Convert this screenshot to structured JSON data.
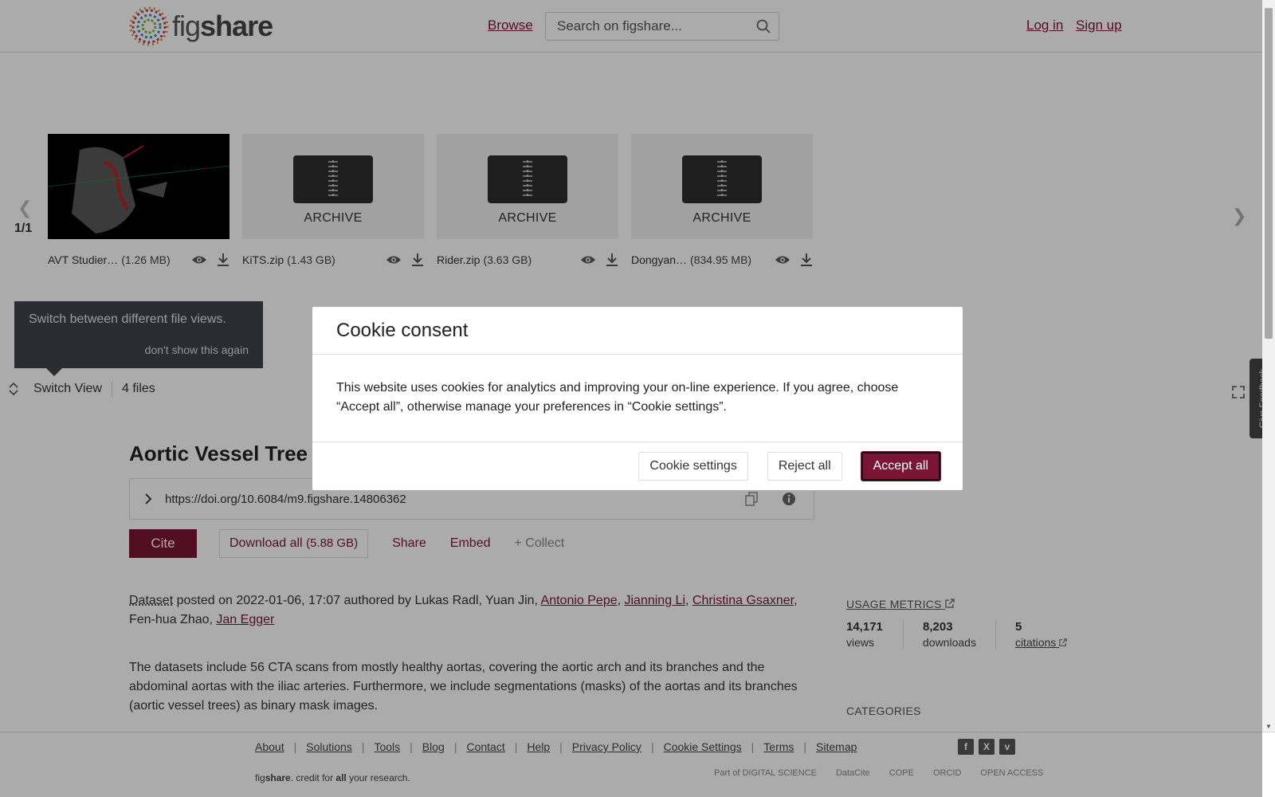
{
  "header": {
    "logo_text_a": "fig",
    "logo_text_b": "share",
    "browse": "Browse",
    "search_placeholder": "Search on figshare...",
    "login": "Log in",
    "signup": "Sign up"
  },
  "carousel": {
    "pager": "1/1",
    "files": [
      {
        "name": "AVT Studier…",
        "size": "(1.26 MB)",
        "kind": "image"
      },
      {
        "name": "KiTS.zip",
        "size": "(1.43 GB)",
        "kind": "archive",
        "label": "ARCHIVE"
      },
      {
        "name": "Rider.zip",
        "size": "(3.63 GB)",
        "kind": "archive",
        "label": "ARCHIVE"
      },
      {
        "name": "Dongyan…",
        "size": "(834.95 MB)",
        "kind": "archive",
        "label": "ARCHIVE"
      }
    ]
  },
  "tooltip": {
    "text": "Switch between different file views.",
    "dismiss": "don't show this again"
  },
  "switchbar": {
    "label": "Switch View",
    "count": "4 files"
  },
  "feedback": "Give Feedback",
  "item": {
    "title": "Aortic Vessel Tree (AV",
    "doi": "https://doi.org/10.6084/m9.figshare.14806362",
    "cite": "Cite",
    "download_all": "Download all",
    "download_size": "(5.88 GB)",
    "share": "Share",
    "embed": "Embed",
    "collect": "+ Collect",
    "dataset": "Dataset",
    "posted_text": " posted on 2022-01-06, 17:07 authored by Lukas Radl, Yuan Jin, ",
    "authors_linked": [
      "Antonio Pepe",
      "Jianning Li",
      "Christina Gsaxner"
    ],
    "author_plain": "Fen-hua Zhao",
    "author_last": "Jan Egger",
    "description": "The datasets include 56 CTA scans from mostly healthy aortas, covering the aortic arch and its branches and the abdominal aortas with the iliac arteries. Furthermore, we include segmentations (masks) of the aortas and its branches (aortic vessel trees) as binary mask images."
  },
  "metrics": {
    "title": "USAGE METRICS",
    "views_num": "14,171",
    "views_lbl": "views",
    "downloads_num": "8,203",
    "downloads_lbl": "downloads",
    "citations_num": "5",
    "citations_lbl": "citations"
  },
  "categories_title": "CATEGORIES",
  "footer": {
    "links": [
      "About",
      "Solutions",
      "Tools",
      "Blog",
      "Contact",
      "Help",
      "Privacy Policy",
      "Cookie Settings",
      "Terms",
      "Sitemap"
    ],
    "tagline_a": "fig",
    "tagline_b": "share",
    "tagline_c": ". credit for ",
    "tagline_d": "all",
    "tagline_e": " your research.",
    "partners": [
      "Part of DIGITAL SCIENCE",
      "DataCite",
      "COPE",
      "ORCID",
      "OPEN ACCESS"
    ]
  },
  "cookie": {
    "title": "Cookie consent",
    "body": "This website uses cookies for analytics and improving your on-line experience. If you agree, choose “Accept all”, otherwise manage your preferences in “Cookie settings”.",
    "settings": "Cookie settings",
    "reject": "Reject all",
    "accept": "Accept all"
  },
  "colors": {
    "brand": "#7a1634",
    "overlay": "rgba(0,0,0,0.33)"
  }
}
